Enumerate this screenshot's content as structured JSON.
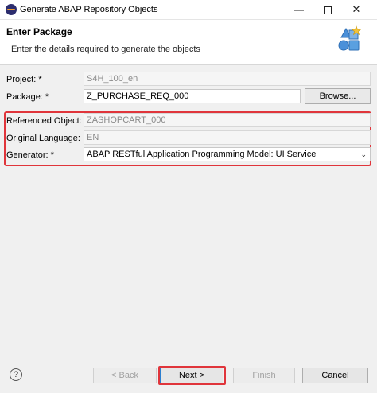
{
  "window": {
    "title": "Generate ABAP Repository Objects",
    "minimize_glyph": "—",
    "close_glyph": "✕"
  },
  "banner": {
    "title": "Enter Package",
    "subtitle": "Enter the details required to generate the objects",
    "icon": "wizard-shapes-icon"
  },
  "form": {
    "project": {
      "label": "Project: *",
      "value": "S4H_100_en"
    },
    "package": {
      "label": "Package: *",
      "value": "Z_PURCHASE_REQ_000"
    },
    "browse_label": "Browse...",
    "referenced_object": {
      "label": "Referenced Object: *",
      "value": "ZASHOPCART_000"
    },
    "original_language": {
      "label": "Original Language:",
      "value": "EN"
    },
    "generator": {
      "label": "Generator: *",
      "value": "ABAP RESTful Application Programming Model: UI Service"
    }
  },
  "buttons": {
    "help": "?",
    "back": "< Back",
    "next": "Next >",
    "finish": "Finish",
    "cancel": "Cancel"
  },
  "colors": {
    "highlight": "#e0353b",
    "focus_border": "#2b7fd0"
  }
}
